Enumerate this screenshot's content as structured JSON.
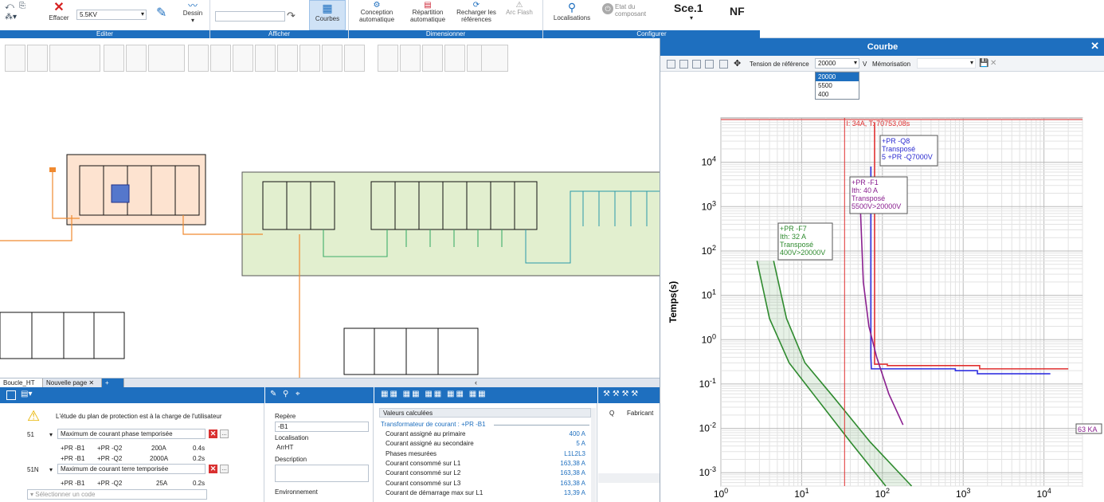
{
  "ribbon": {
    "edit": {
      "delete_label": "Effacer",
      "voltage_value": "5.5KV",
      "draw_label": "Dessin",
      "group_label": "Editer"
    },
    "show": {
      "curves_label": "Courbes",
      "group_label": "Afficher"
    },
    "size": {
      "auto_design_label": "Conception automatique",
      "auto_split_label": "Répartition automatique",
      "reload_label": "Recharger les références",
      "arcflash_label": "Arc Flash",
      "group_label": "Dimensionner"
    },
    "config": {
      "locations_label": "Localisations",
      "component_state_label": "Etat du composant",
      "scenario_label": "Sce.1",
      "nf_label": "NF",
      "group_label": "Configurer"
    }
  },
  "diagram": {
    "tabs": [
      {
        "label": "Boucle_HT"
      },
      {
        "label": "Nouvelle page"
      }
    ],
    "colors": {
      "orange": "#f08a30",
      "green": "#3fae6a",
      "teal": "#2a9aa8",
      "zone_orange": "#fde3d0",
      "zone_green": "#e2efcf"
    }
  },
  "protection": {
    "notice": "L'étude du plan de protection est à la charge de l'utilisateur",
    "codes": [
      {
        "code": "51",
        "description": "Maximum de courant phase temporisée",
        "rows": [
          {
            "a": "+PR -B1",
            "b": "+PR -Q2",
            "current": "200A",
            "time": "0.4s"
          },
          {
            "a": "+PR -B1",
            "b": "+PR -Q2",
            "current": "2000A",
            "time": "0.2s"
          }
        ]
      },
      {
        "code": "51N",
        "description": "Maximum de courant terre temporisée",
        "rows": [
          {
            "a": "+PR -B1",
            "b": "+PR -Q2",
            "current": "25A",
            "time": "0.2s"
          }
        ]
      }
    ],
    "select_placeholder": "Sélectionner un code"
  },
  "properties": {
    "repere_label": "Repère",
    "repere_value": "-B1",
    "localisation_label": "Localisation",
    "localisation_value": "ArrHT",
    "description_label": "Description",
    "environment_label": "Environnement"
  },
  "computed": {
    "header": "Valeurs calculées",
    "section": "Transformateur de courant : +PR -B1",
    "rows": [
      {
        "label": "Courant assigné au primaire",
        "value": "400 A"
      },
      {
        "label": "Courant assigné au secondaire",
        "value": "5 A"
      },
      {
        "label": "Phases mesurées",
        "value": "L1L2L3"
      },
      {
        "label": "Courant consommé sur L1",
        "value": "163,38 A"
      },
      {
        "label": "Courant consommé sur L2",
        "value": "163,38 A"
      },
      {
        "label": "Courant consommé sur L3",
        "value": "163,38 A"
      },
      {
        "label": "Courant de démarrage max sur L1",
        "value": "13,39 A"
      }
    ]
  },
  "parts": {
    "col_q": "Q",
    "col_maker": "Fabricant"
  },
  "courbe": {
    "title": "Courbe",
    "ref_voltage_label": "Tension de référence",
    "ref_voltage_value": "20000",
    "ref_voltage_unit": "V",
    "options": [
      "20000",
      "5500",
      "400"
    ],
    "memo_label": "Mémorisation"
  },
  "chart_data": {
    "type": "line",
    "xscale": "log",
    "yscale": "log",
    "xlim": [
      1,
      30000
    ],
    "ylim": [
      0.0005,
      100000
    ],
    "ylabel": "Temps(s)",
    "x_ticks": [
      "10^0",
      "10^1",
      "10^2",
      "10^3",
      "10^4"
    ],
    "y_ticks": [
      "10^4",
      "10^3",
      "10^2",
      "10^1",
      "10^0",
      "10^-1",
      "10^-2",
      "10^-3"
    ],
    "cursor": {
      "x": 34,
      "label": "I: 34A, T: 70753,08s",
      "color": "#e03030"
    },
    "annotations": [
      {
        "lines": [
          "+PR -Q8",
          "Transposé",
          "5 +PR -Q7000V"
        ],
        "color": "#2a2ad0"
      },
      {
        "lines": [
          "+PR -F1",
          "Ith: 40 A",
          "Transposé",
          "5500V>20000V"
        ],
        "color": "#8a2090"
      },
      {
        "lines": [
          "+PR -F7",
          "Ith: 32 A",
          "Transposé",
          "400V>20000V"
        ],
        "color": "#2e8a2e"
      },
      {
        "lines": [
          "63 KA"
        ],
        "color": "#8a2090"
      }
    ],
    "series": [
      {
        "color": "#e03030",
        "x": [
          80,
          80,
          115,
          115,
          1600,
          1600,
          20000
        ],
        "y": [
          80000,
          0.28,
          0.28,
          0.26,
          0.26,
          0.22,
          0.22
        ]
      },
      {
        "color": "#3030e0",
        "x": [
          72,
          72,
          73,
          800,
          800,
          1500,
          1500,
          12000
        ],
        "y": [
          8000,
          0.4,
          0.22,
          0.22,
          0.2,
          0.2,
          0.17,
          0.17
        ]
      },
      {
        "color": "#8a2090",
        "x": [
          52,
          58,
          68,
          85,
          120,
          180
        ],
        "y": [
          3000,
          20,
          2,
          0.4,
          0.06,
          0.012
        ]
      },
      {
        "color": "#2e8a2e",
        "x": [
          2.8,
          4,
          7,
          15,
          40,
          110
        ],
        "y": [
          60,
          3,
          0.3,
          0.05,
          0.005,
          0.0005
        ]
      },
      {
        "color": "#2e8a2e",
        "x": [
          4.5,
          6.5,
          11,
          25,
          70,
          230
        ],
        "y": [
          60,
          3,
          0.3,
          0.05,
          0.005,
          0.0005
        ]
      }
    ]
  }
}
